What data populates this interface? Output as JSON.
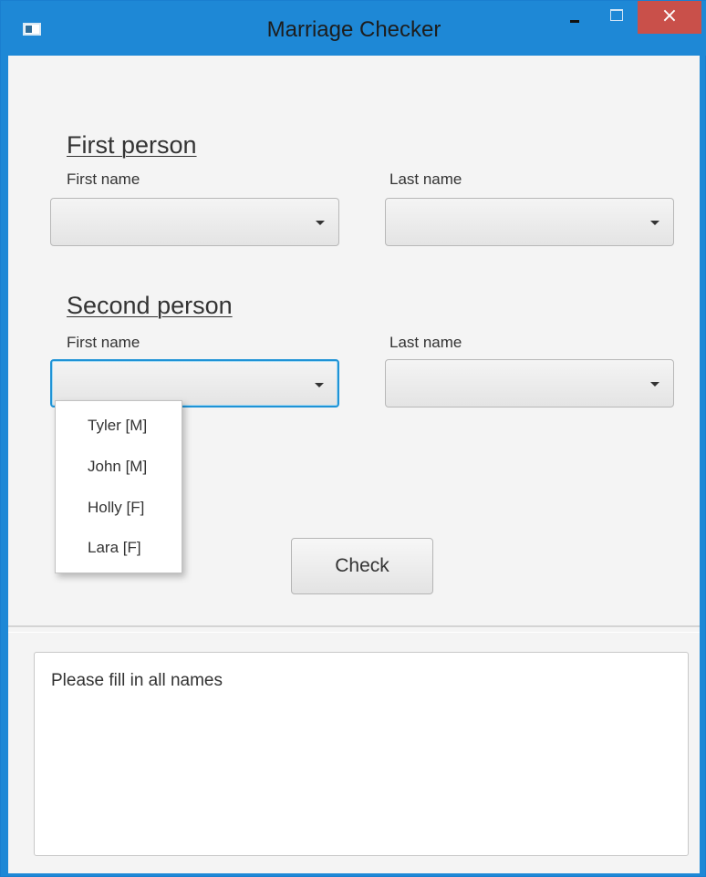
{
  "window": {
    "title": "Marriage Checker",
    "close_symbol": "×",
    "accent_color": "#1e88d6",
    "close_color": "#c9504a"
  },
  "first_person": {
    "heading": "First person",
    "first_name_label": "First name",
    "last_name_label": "Last name",
    "first_name_value": "",
    "last_name_value": ""
  },
  "second_person": {
    "heading": "Second person",
    "first_name_label": "First name",
    "last_name_label": "Last name",
    "first_name_value": "",
    "last_name_value": ""
  },
  "dropdown": {
    "options": [
      "Tyler [M]",
      "John [M]",
      "Holly [F]",
      "Lara [F]"
    ]
  },
  "actions": {
    "check_label": "Check"
  },
  "output": {
    "message": "Please fill in all names"
  },
  "icons": {
    "app": "app-icon",
    "dropdown": "chevron-down-icon"
  }
}
